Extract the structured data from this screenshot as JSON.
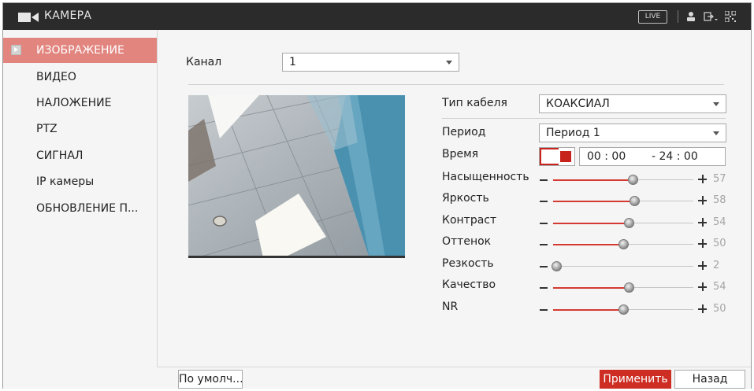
{
  "header": {
    "title": "КАМЕРА",
    "live_label": "LIVE"
  },
  "sidebar": {
    "items": [
      {
        "label": "ИЗОБРАЖЕНИЕ",
        "active": true
      },
      {
        "label": "ВИДЕО",
        "active": false
      },
      {
        "label": "НАЛОЖЕНИЕ",
        "active": false
      },
      {
        "label": "PTZ",
        "active": false
      },
      {
        "label": "СИГНАЛ",
        "active": false
      },
      {
        "label": "IP камеры",
        "active": false
      },
      {
        "label": "ОБНОВЛЕНИЕ П...",
        "active": false
      }
    ]
  },
  "channel": {
    "label": "Канал",
    "value": "1"
  },
  "settings": {
    "cable_type": {
      "label": "Тип кабеля",
      "value": "КОАКСИАЛ"
    },
    "period": {
      "label": "Период",
      "value": "Период 1"
    },
    "time": {
      "label": "Время",
      "start": "00 : 00",
      "end": "- 24 : 00"
    },
    "sliders": [
      {
        "label": "Насыщенность",
        "value": 57
      },
      {
        "label": "Яркость",
        "value": 58
      },
      {
        "label": "Контраст",
        "value": 54
      },
      {
        "label": "Оттенок",
        "value": 50
      },
      {
        "label": "Резкость",
        "value": 2
      },
      {
        "label": "Качество",
        "value": 54
      },
      {
        "label": "NR",
        "value": 50
      }
    ]
  },
  "buttons": {
    "default_label": "По умолч...",
    "apply_label": "Применить",
    "back_label": "Назад"
  },
  "colors": {
    "accent": "#cd2d23",
    "active_nav": "#e2857f",
    "topbar": "#2b2b2b"
  }
}
